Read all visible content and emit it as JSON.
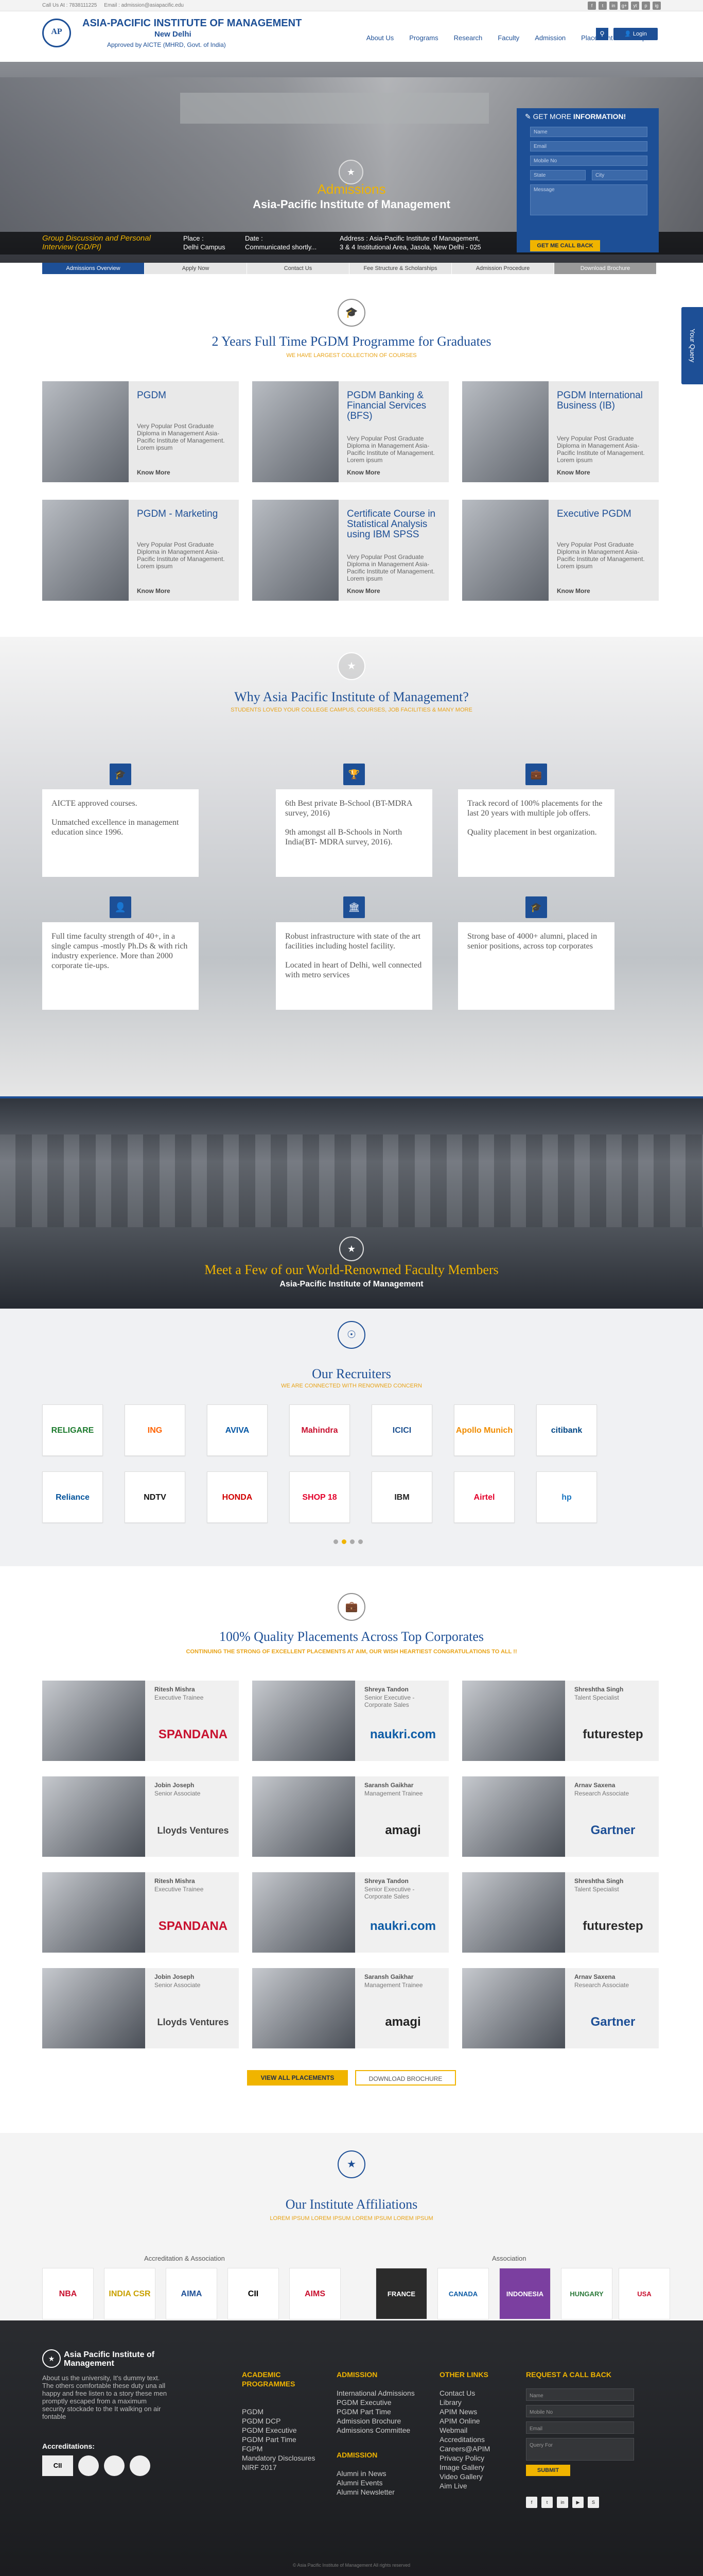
{
  "topbar": {
    "call": "Call Us At : 7838111225",
    "email": "Email : admission@asiapacific.edu",
    "social": [
      "f",
      "t",
      "in",
      "g+",
      "yt",
      "p",
      "ig"
    ]
  },
  "header": {
    "title": "ASIA-PACIFIC INSTITUTE OF MANAGEMENT",
    "city": "New Delhi",
    "approved": "Approved by AICTE (MHRD, Govt. of India)",
    "logo_text": "AP",
    "nav": [
      "About Us",
      "Programs",
      "Research",
      "Faculty",
      "Admission",
      "Placement",
      "Campus"
    ],
    "login": "Login"
  },
  "hero": {
    "admissions": "Admissions",
    "name": "Asia-Pacific Institute of Management",
    "gd": "Group Discussion and Personal Interview (GD/PI)",
    "place_label": "Place :",
    "place_value": "Delhi Campus",
    "date_label": "Date :",
    "date_value": "Communicated shortly...",
    "address_label": "Address : Asia-Pacific Institute of Management,",
    "address_value": "3 & 4 Institutional Area, Jasola, New Delhi - 025",
    "form": {
      "title_a": "GET MORE",
      "title_b": " INFORMATION!",
      "name": "Name",
      "email": "Email",
      "mobile": "Mobile No",
      "state": "State",
      "city": "City",
      "message": "Message",
      "callback": "GET ME CALL BACK"
    }
  },
  "tabs": [
    "Admissions Overview",
    "Apply Now",
    "Contact Us",
    "Fee Structure & Scholarships",
    "Admission Procedure",
    "Download Brochure"
  ],
  "side_query": "Your Query",
  "programmes": {
    "title": "2 Years Full Time PGDM Programme for Graduates",
    "subtitle": "We have largest collection of courses",
    "know_more": "Know More",
    "desc": "Very Popular Post Graduate Diploma in Management Asia-Pacific Institute of Management. Lorem ipsum",
    "items": [
      "PGDM",
      "PGDM Banking & Financial Services (BFS)",
      "PGDM International Business (IB)",
      "PGDM - Marketing",
      "Certificate Course in Statistical Analysis using IBM SPSS",
      "Executive PGDM"
    ]
  },
  "why": {
    "title": "Why Asia Pacific Institute of Management?",
    "subtitle": "Students loved your college campus, courses, job facilities & many more",
    "cards": [
      [
        "AICTE approved courses.",
        "Unmatched excellence in management education since 1996."
      ],
      [
        "6th Best private B-School (BT-MDRA survey, 2016)",
        "9th amongst all B-Schools in North India(BT- MDRA survey, 2016)."
      ],
      [
        "Track record of 100% placements for the last 20 years with multiple job offers.",
        "Quality placement in best organization."
      ],
      [
        "Full time faculty strength of 40+, in a single campus -mostly Ph.Ds & with rich industry experience. More than 2000 corporate tie-ups."
      ],
      [
        "Robust infrastructure with state of the art facilities including hostel facility.",
        "Located in heart of Delhi, well connected with metro services"
      ],
      [
        "Strong base of 4000+ alumni, placed in senior positions, across top corporates"
      ]
    ]
  },
  "faculty": {
    "title": "Meet a Few of our World-Renowned Faculty Members",
    "sub": "Asia-Pacific Institute of Management"
  },
  "recruiters": {
    "title": "Our Recruiters",
    "subtitle": "We are connected with renowned concern",
    "row1": [
      "RELIGARE",
      "ING",
      "AVIVA",
      "Mahindra",
      "ICICI",
      "Apollo Munich",
      "citibank"
    ],
    "row2": [
      "Reliance",
      "NDTV",
      "HONDA",
      "SHOP 18",
      "IBM",
      "Airtel",
      "hp"
    ]
  },
  "placements": {
    "title": "100% Quality Placements Across Top Corporates",
    "subtitle": "Continuing the strong of excellent placements at AIM, our wish heartiest congratulations to all !!",
    "cards": [
      {
        "name": "Ritesh Mishra",
        "role": "Executive Trainee",
        "company": "SPANDANA"
      },
      {
        "name": "Shreya Tandon",
        "role": "Senior Executive - Corporate Sales",
        "company": "naukri.com"
      },
      {
        "name": "Shreshtha Singh",
        "role": "Talent Specialist",
        "company": "futurestep"
      },
      {
        "name": "Jobin Joseph",
        "role": "Senior Associate",
        "company": "Lloyds Ventures"
      },
      {
        "name": "Saransh Gaikhar",
        "role": "Management Trainee",
        "company": "amagi"
      },
      {
        "name": "Arnav Saxena",
        "role": "Research Associate",
        "company": "Gartner"
      },
      {
        "name": "Ritesh Mishra",
        "role": "Executive Trainee",
        "company": "SPANDANA"
      },
      {
        "name": "Shreya Tandon",
        "role": "Senior Executive - Corporate Sales",
        "company": "naukri.com"
      },
      {
        "name": "Shreshtha Singh",
        "role": "Talent Specialist",
        "company": "futurestep"
      },
      {
        "name": "Jobin Joseph",
        "role": "Senior Associate",
        "company": "Lloyds Ventures"
      },
      {
        "name": "Saransh Gaikhar",
        "role": "Management Trainee",
        "company": "amagi"
      },
      {
        "name": "Arnav Saxena",
        "role": "Research Associate",
        "company": "Gartner"
      }
    ],
    "view_all": "VIEW ALL PLACEMENTS",
    "download": "DOWNLOAD BROCHURE"
  },
  "affiliations": {
    "title": "Our Institute Affiliations",
    "subtitle": "Lorem ipsum lorem ipsum lorem ipsum lorem ipsum",
    "accreditation_label": "Accreditation & Association",
    "association_label": "Association",
    "accreditation": [
      "NBA",
      "INDIA CSR",
      "AIMA",
      "CII",
      "AIMS"
    ],
    "association": [
      "FRANCE",
      "CANADA",
      "INDONESIA",
      "HUNGARY",
      "USA"
    ]
  },
  "footer": {
    "brand": "Asia Pacific Institute of Management",
    "about": "About us the university, It's dummy text. The others comfortable these duty una all happy and free listen to a story these men promptly escaped from a maximum security stockade to the It walking on air fontable",
    "accreditations": "Accreditations:",
    "acad_title": "ACADEMIC PROGRAMMES",
    "acad": [
      "PGDM",
      "PGDM DCP",
      "PGDM Executive",
      "PGDM Part Time",
      "FGPM",
      "Mandatory Disclosures",
      "NIRF 2017"
    ],
    "adm_title": "ADMISSION",
    "adm": [
      "International Admissions",
      "PGDM Executive",
      "PGDM Part Time",
      "Admission Brochure",
      "Admissions Committee"
    ],
    "adm2_title": "ADMISSION",
    "adm2": [
      "Alumni in News",
      "Alumni Events",
      "Alumni Newsletter"
    ],
    "other_title": "OTHER LINKS",
    "other": [
      "Contact Us",
      "Library",
      "APIM News",
      "APIM Online",
      "Webmail",
      "Accreditations",
      "Careers@APIM",
      "Privacy Policy",
      "Image Gallery",
      "Video Gallery",
      "Aim Live"
    ],
    "req_title": "REQUEST A CALL BACK",
    "req_fields": [
      "Name",
      "Mobile No",
      "Email",
      "Query For"
    ],
    "submit": "SUBMIT",
    "copyright": "© Asia Pacific Institute of Management All rights reserved"
  }
}
